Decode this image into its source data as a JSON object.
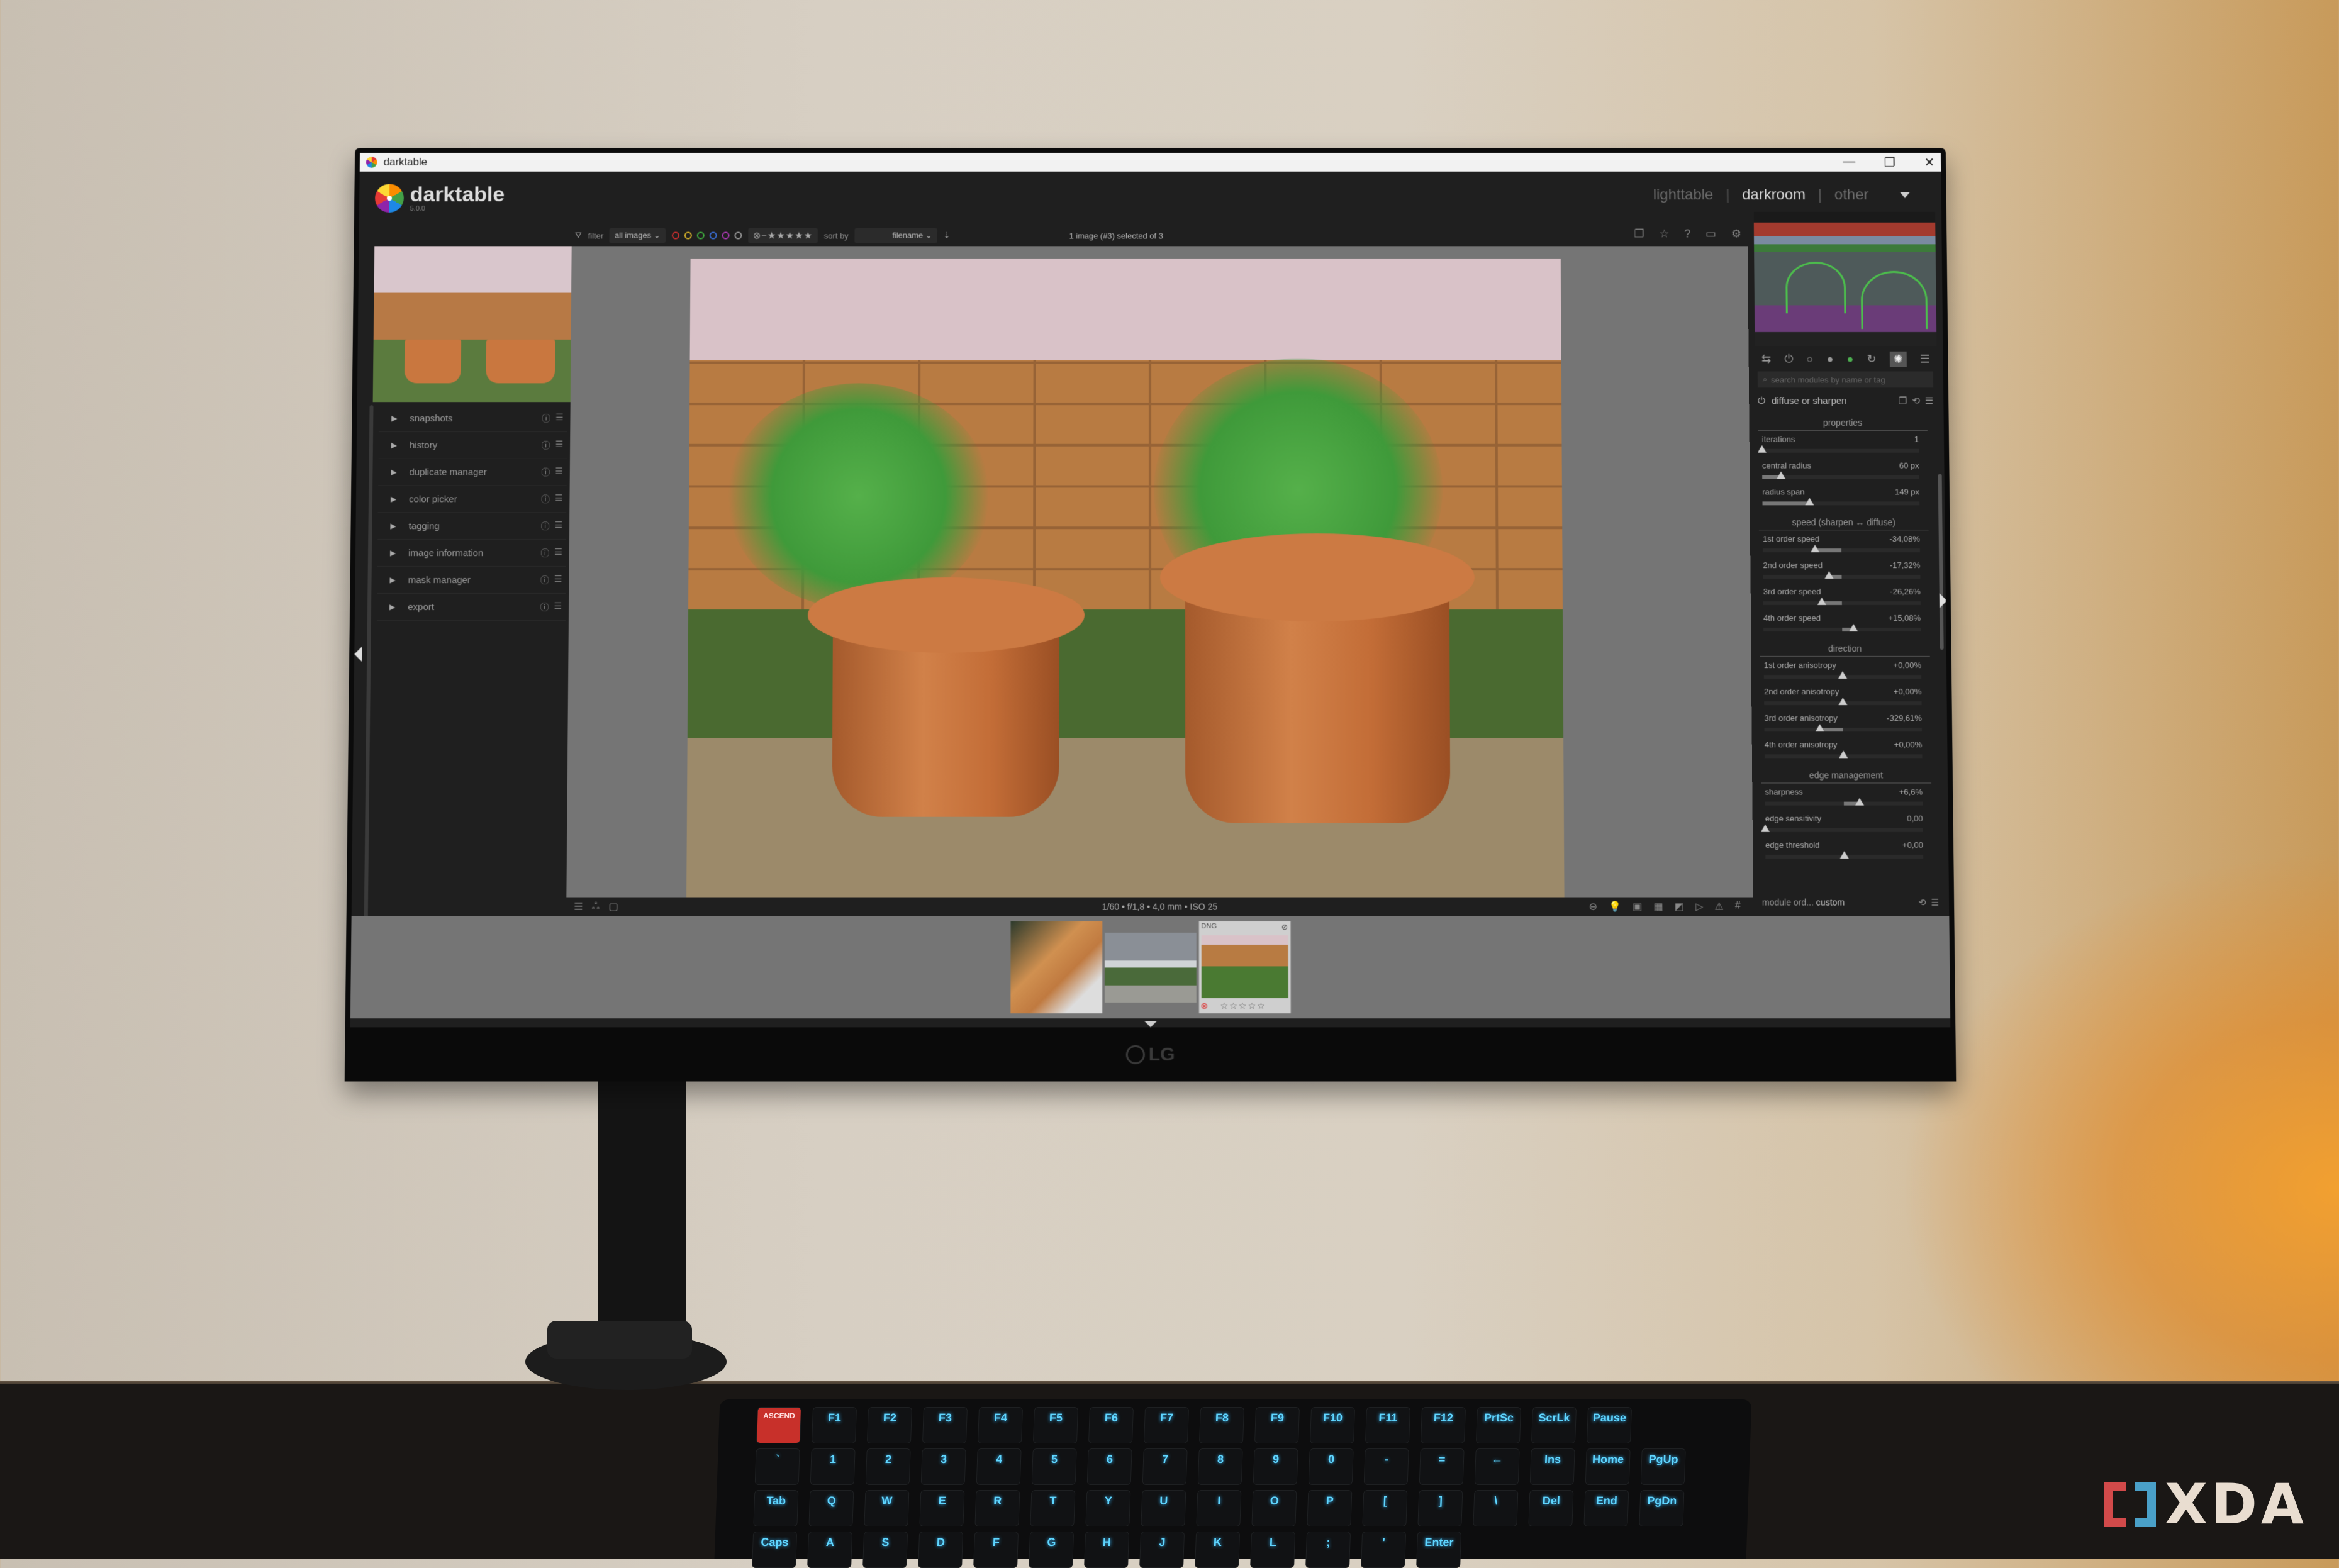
{
  "window": {
    "title": "darktable",
    "controls": {
      "minimize": "—",
      "maximize": "❐",
      "close": "✕"
    }
  },
  "header": {
    "app_name": "darktable",
    "version": "5.0.0",
    "views": [
      {
        "label": "lighttable",
        "active": false
      },
      {
        "label": "darkroom",
        "active": true
      },
      {
        "label": "other",
        "active": false
      }
    ],
    "separator": "|"
  },
  "filterbar": {
    "filter_label": "filter",
    "filter_value": "all images",
    "color_labels": [
      "#d22f2f",
      "#d6b22a",
      "#3fae3f",
      "#3a6fd8",
      "#b03ab8",
      "#9a9a9a"
    ],
    "rating": "⊗−★★★★★",
    "sort_label": "sort by",
    "sort_value": "filename",
    "selection_status": "1 image (#3) selected of 3"
  },
  "top_icons": [
    "grouping-icon",
    "star-icon",
    "help-icon",
    "shortcuts-icon",
    "gear-icon"
  ],
  "left_panel": {
    "modules": [
      {
        "label": "snapshots"
      },
      {
        "label": "history"
      },
      {
        "label": "duplicate manager"
      },
      {
        "label": "color picker"
      },
      {
        "label": "tagging"
      },
      {
        "label": "image information"
      },
      {
        "label": "mask manager"
      },
      {
        "label": "export"
      }
    ]
  },
  "image_info": {
    "exif": "1/60 • f/1,8 • 4,0 mm • ISO 25"
  },
  "right_panel": {
    "search_placeholder": "search modules by name or tag",
    "module_name": "diffuse or sharpen",
    "sections": [
      {
        "title": "properties",
        "params": [
          {
            "label": "iterations",
            "value": "1",
            "fraction": 0.0,
            "origin": 0.0
          },
          {
            "label": "central radius",
            "value": "60 px",
            "fraction": 0.12,
            "origin": 0.0
          },
          {
            "label": "radius span",
            "value": "149 px",
            "fraction": 0.3,
            "origin": 0.0
          }
        ]
      },
      {
        "title": "speed (sharpen ↔ diffuse)",
        "params": [
          {
            "label": "1st order speed",
            "value": "-34,08%",
            "fraction": 0.33,
            "origin": 0.5
          },
          {
            "label": "2nd order speed",
            "value": "-17,32%",
            "fraction": 0.42,
            "origin": 0.5
          },
          {
            "label": "3rd order speed",
            "value": "-26,26%",
            "fraction": 0.37,
            "origin": 0.5
          },
          {
            "label": "4th order speed",
            "value": "+15,08%",
            "fraction": 0.57,
            "origin": 0.5
          }
        ]
      },
      {
        "title": "direction",
        "params": [
          {
            "label": "1st order anisotropy",
            "value": "+0,00%",
            "fraction": 0.5,
            "origin": 0.5
          },
          {
            "label": "2nd order anisotropy",
            "value": "+0,00%",
            "fraction": 0.5,
            "origin": 0.5
          },
          {
            "label": "3rd order anisotropy",
            "value": "-329,61%",
            "fraction": 0.35,
            "origin": 0.5
          },
          {
            "label": "4th order anisotropy",
            "value": "+0,00%",
            "fraction": 0.5,
            "origin": 0.5
          }
        ]
      },
      {
        "title": "edge management",
        "params": [
          {
            "label": "sharpness",
            "value": "+6,6%",
            "fraction": 0.6,
            "origin": 0.5
          },
          {
            "label": "edge sensitivity",
            "value": "0,00",
            "fraction": 0.0,
            "origin": 0.0
          },
          {
            "label": "edge threshold",
            "value": "+0,00",
            "fraction": 0.5,
            "origin": 0.5
          }
        ]
      }
    ],
    "module_order_label": "module ord...",
    "module_order_value": "custom"
  },
  "filmstrip": {
    "items": [
      {
        "name": "kitten"
      },
      {
        "name": "cloudy-landscape"
      },
      {
        "name": "plant-pots",
        "format": "DNG",
        "selected": true,
        "rating": "☆☆☆☆☆"
      }
    ]
  },
  "monitor_brand": "LG",
  "watermark": "XDA",
  "keyboard": {
    "row_fn": [
      "ASCEND",
      "F1",
      "F2",
      "F3",
      "F4",
      "F5",
      "F6",
      "F7",
      "F8",
      "F9",
      "F10",
      "F11",
      "F12",
      "PrtSc",
      "ScrLk",
      "Pause"
    ],
    "row_num": [
      "`",
      "1",
      "2",
      "3",
      "4",
      "5",
      "6",
      "7",
      "8",
      "9",
      "0",
      "-",
      "=",
      "←",
      "Ins",
      "Home",
      "PgUp"
    ],
    "row_q": [
      "Tab",
      "Q",
      "W",
      "E",
      "R",
      "T",
      "Y",
      "U",
      "I",
      "O",
      "P",
      "[",
      "]",
      "\\",
      "Del",
      "End",
      "PgDn"
    ],
    "row_a": [
      "Caps",
      "A",
      "S",
      "D",
      "F",
      "G",
      "H",
      "J",
      "K",
      "L",
      ";",
      "'",
      "Enter"
    ]
  }
}
